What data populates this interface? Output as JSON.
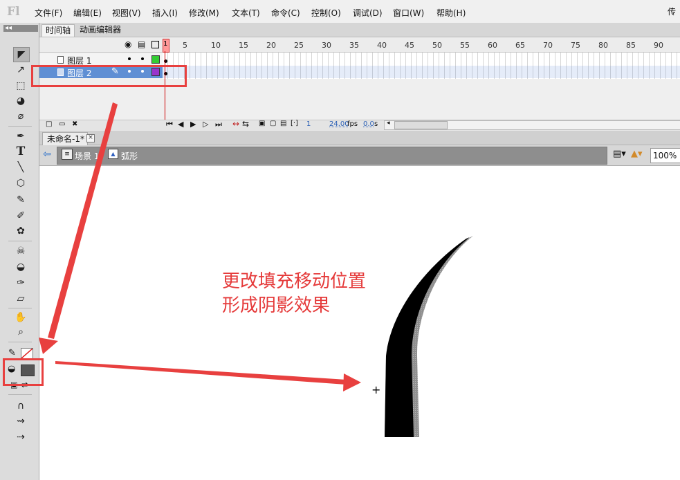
{
  "app": {
    "logo": "Fl",
    "workspace": "传统"
  },
  "menubar": {
    "items": [
      "文件(F)",
      "编辑(E)",
      "视图(V)",
      "插入(I)",
      "修改(M)",
      "文本(T)",
      "命令(C)",
      "控制(O)",
      "调试(D)",
      "窗口(W)",
      "帮助(H)"
    ]
  },
  "toolbar": {
    "collapse": "◂◂",
    "tools": [
      "selection-tool",
      "subselection-tool",
      "free-transform-tool",
      "3d-rotation-tool",
      "lasso-tool",
      "pen-tool",
      "text-tool",
      "line-tool",
      "polystar-tool",
      "pencil-tool",
      "brush-tool",
      "deco-tool",
      "bone-tool",
      "paint-bucket-tool",
      "eyedropper-tool",
      "eraser-tool",
      "hand-tool",
      "zoom-tool"
    ],
    "stroke_color": "none",
    "fill_color": "#555555"
  },
  "timeline": {
    "tabs": [
      "时间轴",
      "动画编辑器"
    ],
    "ruler": [
      "5",
      "10",
      "15",
      "20",
      "25",
      "30",
      "35",
      "40",
      "45",
      "50",
      "55",
      "60",
      "65",
      "70",
      "75",
      "80",
      "85",
      "90"
    ],
    "playhead_frame": "1",
    "layers": [
      {
        "name": "图层 1",
        "color": "#33cc33",
        "selected": false
      },
      {
        "name": "图层 2",
        "color": "#9933cc",
        "selected": true
      }
    ],
    "footer": {
      "current_frame": "1",
      "fps": "24.00",
      "fps_unit": "fps",
      "time": "0.0",
      "time_unit": "s"
    }
  },
  "document": {
    "tab_title": "未命名-1*",
    "close": "×"
  },
  "editbar": {
    "scene": "场景 1",
    "symbol": "弧形",
    "zoom": "100%"
  },
  "stage": {
    "annotation": [
      "更改填充移动位置",
      "形成阴影效果"
    ],
    "cursor": "+"
  },
  "colors": {
    "highlight_red": "#e8403f",
    "shape_fill": "#000000",
    "shadow_fill": "#8a8a8a",
    "layer_selected": "#5f8fd4"
  }
}
